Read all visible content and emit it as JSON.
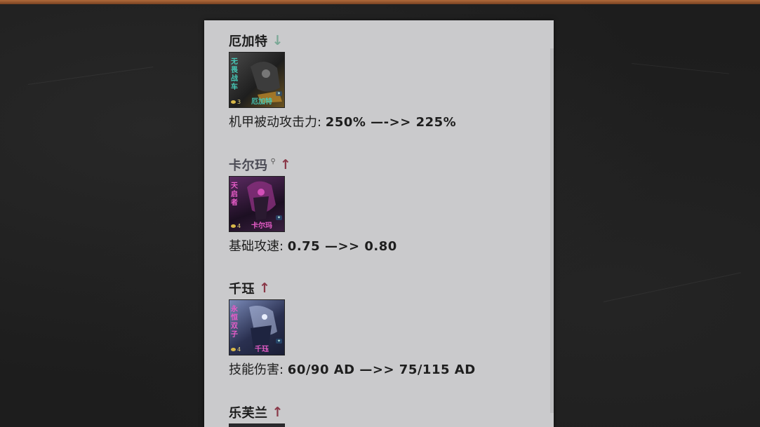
{
  "entries": [
    {
      "name": "厄加特",
      "trend": "down",
      "arrow": "↓",
      "trait_label": "无畏战车",
      "cost": "3",
      "portrait_label": "厄加特",
      "stat_label": "机甲被动攻击力: ",
      "stat_change": "250% —->> 225%",
      "colors": {
        "bg": "#2b2b2b",
        "trait": "#46c7b6",
        "name": "#46c7b6"
      }
    },
    {
      "name": "卡尔玛",
      "trend": "up",
      "arrow": "↑",
      "search_icon": "magnifier",
      "trait_label": "天启者",
      "cost": "4",
      "portrait_label": "卡尔玛",
      "stat_label": "基础攻速: ",
      "stat_change": "0.75 —>> 0.80",
      "colors": {
        "bg": "#3a1f3e",
        "trait": "#e65cc8",
        "name": "#e65cc8"
      }
    },
    {
      "name": "千珏",
      "trend": "up",
      "arrow": "↑",
      "trait_label": "永恒双子",
      "cost": "4",
      "portrait_label": "千珏",
      "stat_label": "技能伤害: ",
      "stat_change": "60/90 AD —>> 75/115 AD",
      "colors": {
        "bg": "#2a3050",
        "trait": "#e65cc8",
        "name": "#e65cc8"
      }
    },
    {
      "name": "乐芙兰",
      "trend": "up",
      "arrow": "↑"
    }
  ]
}
